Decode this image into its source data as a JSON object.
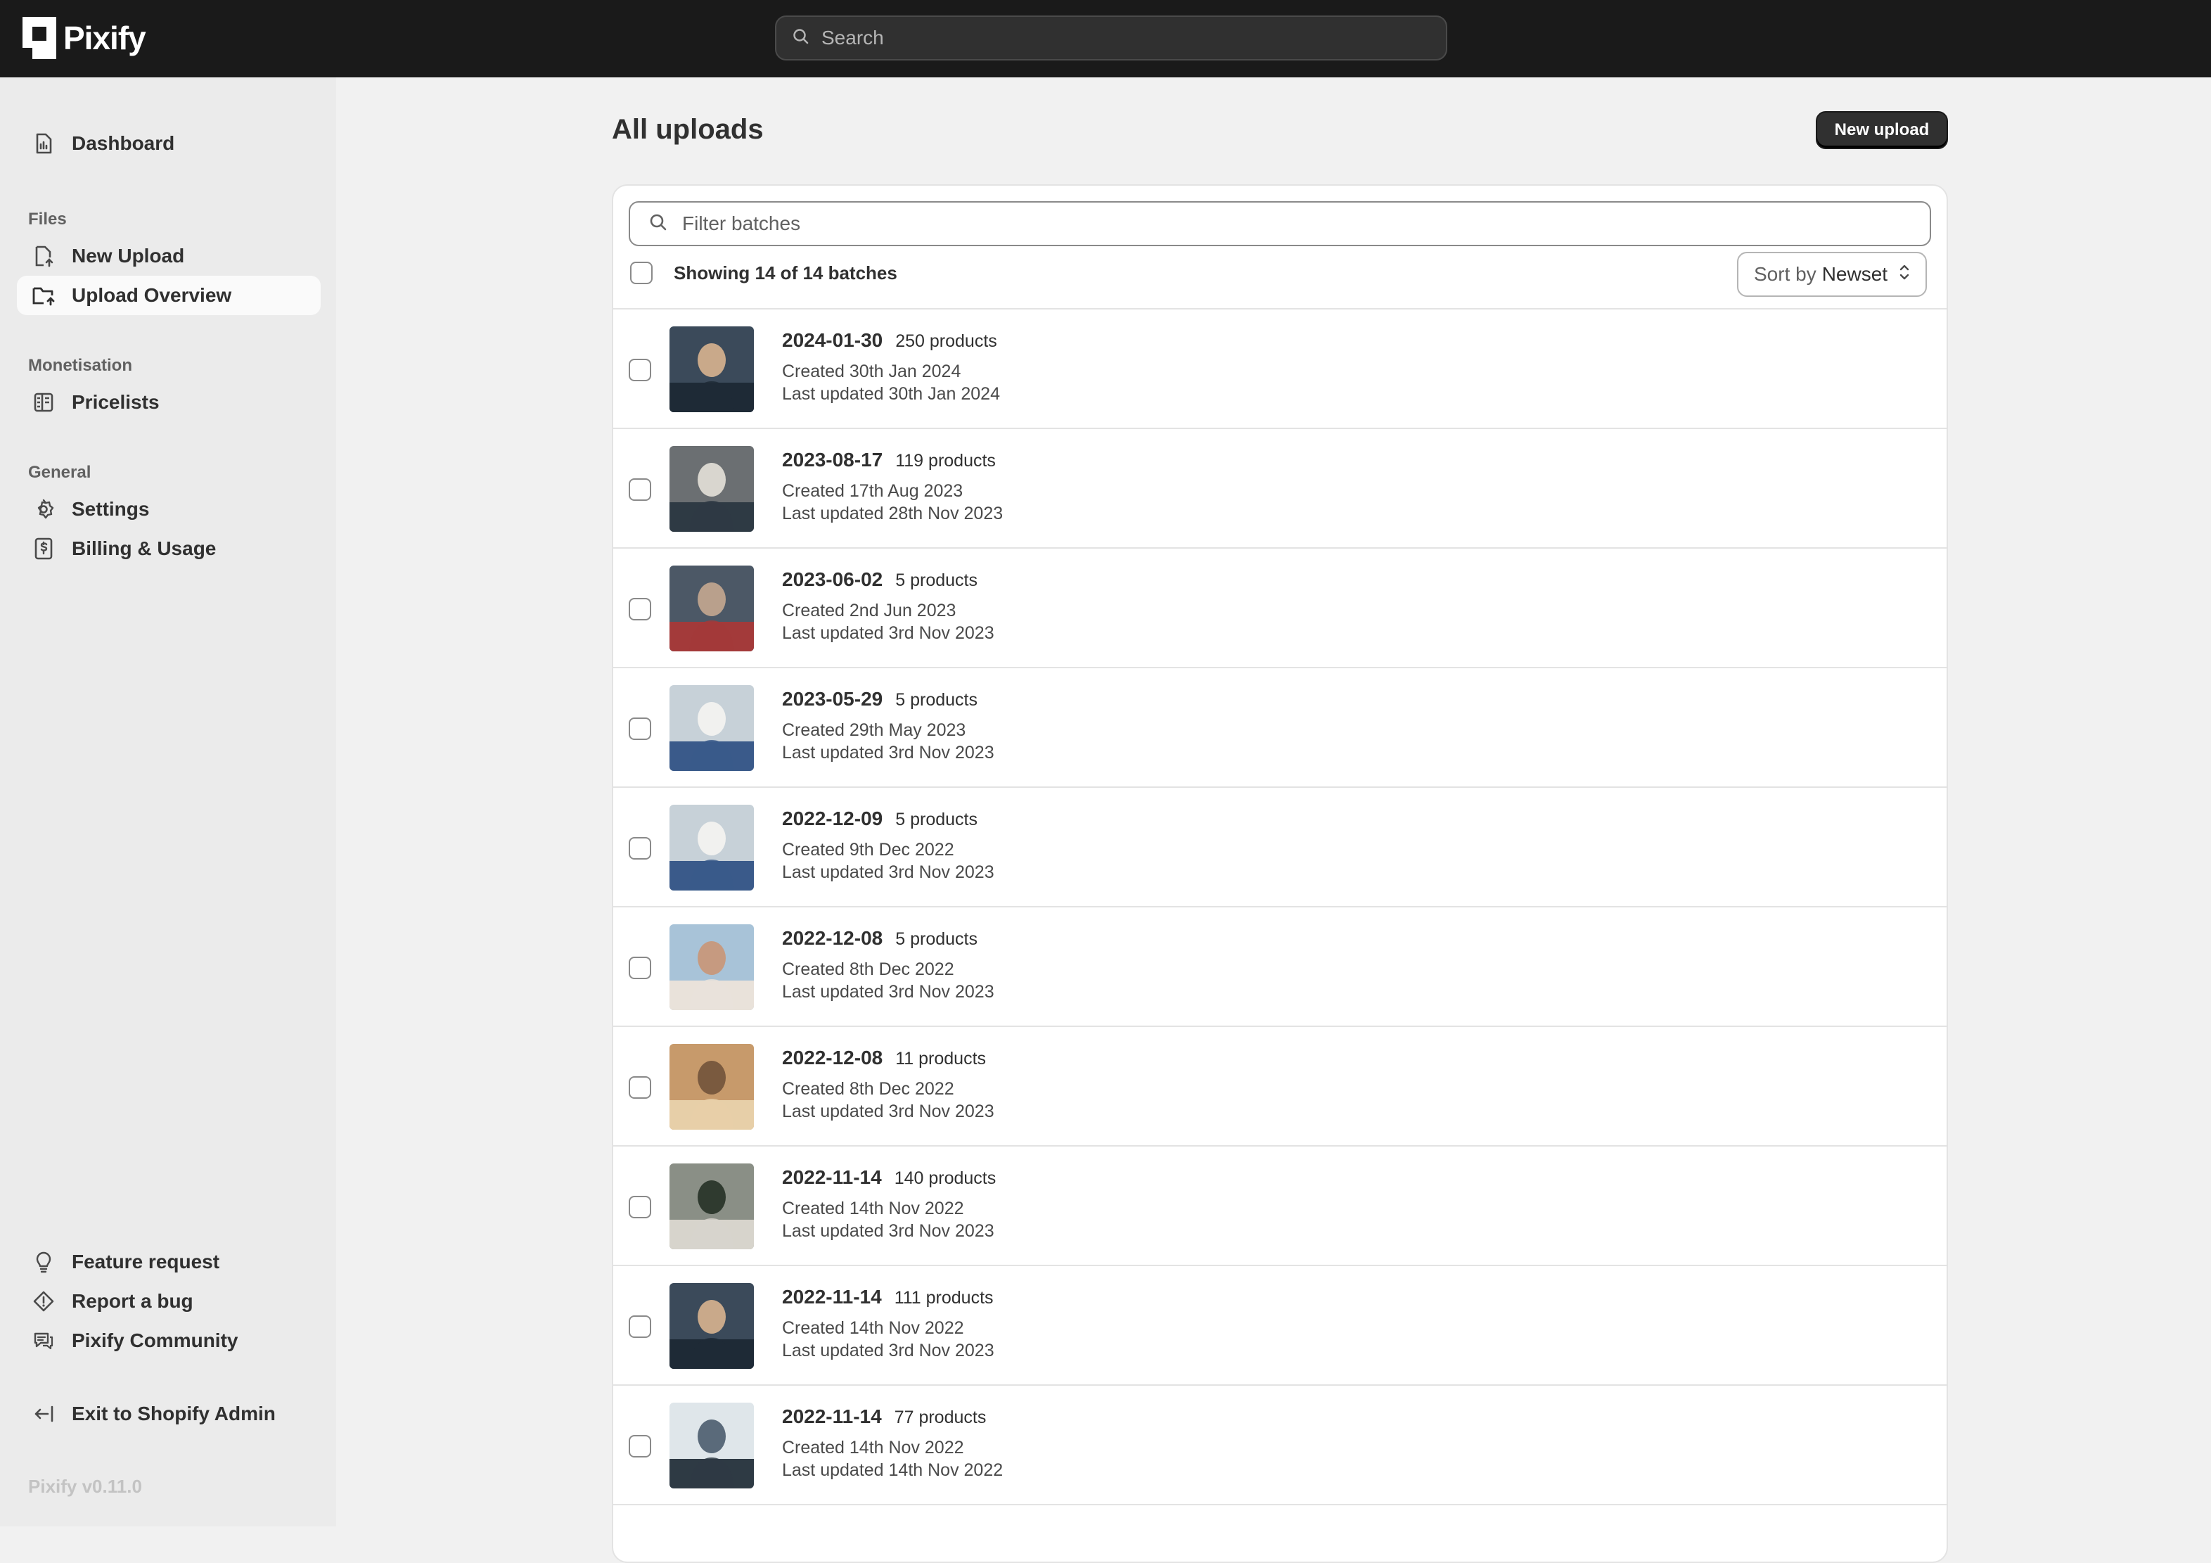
{
  "app": {
    "name": "Pixify",
    "version": "Pixify v0.11.0"
  },
  "topbar": {
    "search_placeholder": "Search"
  },
  "sidebar": {
    "dashboard": "Dashboard",
    "files_label": "Files",
    "new_upload": "New Upload",
    "upload_overview": "Upload Overview",
    "monetisation_label": "Monetisation",
    "pricelists": "Pricelists",
    "general_label": "General",
    "settings": "Settings",
    "billing": "Billing & Usage",
    "feature_request": "Feature request",
    "report_bug": "Report a bug",
    "community": "Pixify Community",
    "exit": "Exit to Shopify Admin"
  },
  "main": {
    "title": "All uploads",
    "new_upload_button": "New upload",
    "filter_placeholder": "Filter batches",
    "showing": "Showing 14 of 14 batches",
    "sort_label": "Sort by",
    "sort_value": "Newset"
  },
  "batches": [
    {
      "name": "2024-01-30",
      "products": "250 products",
      "created": "Created 30th Jan 2024",
      "updated": "Last updated 30th Jan 2024",
      "thumb": [
        "#3b4a5a",
        "#c9a98a",
        "#1e2a36"
      ]
    },
    {
      "name": "2023-08-17",
      "products": "119 products",
      "created": "Created 17th Aug 2023",
      "updated": "Last updated 28th Nov 2023",
      "thumb": [
        "#6b6f72",
        "#d9d6cf",
        "#2e3a44"
      ]
    },
    {
      "name": "2023-06-02",
      "products": "5 products",
      "created": "Created 2nd Jun 2023",
      "updated": "Last updated 3rd Nov 2023",
      "thumb": [
        "#4c5866",
        "#b9a08c",
        "#a33a3a"
      ]
    },
    {
      "name": "2023-05-29",
      "products": "5 products",
      "created": "Created 29th May 2023",
      "updated": "Last updated 3rd Nov 2023",
      "thumb": [
        "#c7d1d8",
        "#f1f1ef",
        "#3a5a8a"
      ]
    },
    {
      "name": "2022-12-09",
      "products": "5 products",
      "created": "Created 9th Dec 2022",
      "updated": "Last updated 3rd Nov 2023",
      "thumb": [
        "#c7d1d8",
        "#f1f1ef",
        "#3a5a8a"
      ]
    },
    {
      "name": "2022-12-08",
      "products": "5 products",
      "created": "Created 8th Dec 2022",
      "updated": "Last updated 3rd Nov 2023",
      "thumb": [
        "#a8c3d8",
        "#c69a80",
        "#e9e2da"
      ]
    },
    {
      "name": "2022-12-08",
      "products": "11 products",
      "created": "Created 8th Dec 2022",
      "updated": "Last updated 3rd Nov 2023",
      "thumb": [
        "#c79a6b",
        "#7a5a3f",
        "#e7cfa8"
      ]
    },
    {
      "name": "2022-11-14",
      "products": "140 products",
      "created": "Created 14th Nov 2022",
      "updated": "Last updated 3rd Nov 2023",
      "thumb": [
        "#8a8f86",
        "#2f3a2f",
        "#d7d4cc"
      ]
    },
    {
      "name": "2022-11-14",
      "products": "111 products",
      "created": "Created 14th Nov 2022",
      "updated": "Last updated 3rd Nov 2023",
      "thumb": [
        "#3b4a5a",
        "#c9a98a",
        "#1e2a36"
      ]
    },
    {
      "name": "2022-11-14",
      "products": "77 products",
      "created": "Created 14th Nov 2022",
      "updated": "Last updated 14th Nov 2022",
      "thumb": [
        "#dfe6ea",
        "#5a6a7a",
        "#2e3a44"
      ]
    }
  ]
}
